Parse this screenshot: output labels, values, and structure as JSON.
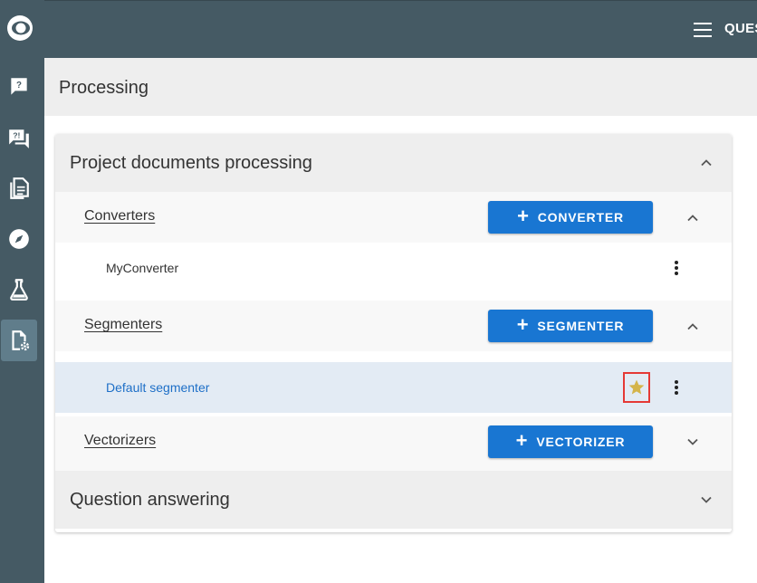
{
  "app": {
    "title_truncated": "QUES"
  },
  "sidebar": {
    "items": [
      {
        "icon": "question-chat-icon"
      },
      {
        "icon": "forum-alert-icon"
      },
      {
        "icon": "documents-icon"
      },
      {
        "icon": "compass-icon"
      },
      {
        "icon": "flask-icon"
      },
      {
        "icon": "file-settings-icon",
        "active": true
      }
    ]
  },
  "page": {
    "title": "Processing"
  },
  "panels": {
    "documents": {
      "title": "Project documents processing",
      "converters": {
        "label": "Converters",
        "button": "CONVERTER",
        "items": [
          "MyConverter"
        ]
      },
      "segmenters": {
        "label": "Segmenters",
        "button": "SEGMENTER",
        "items": [
          "Default segmenter"
        ]
      },
      "vectorizers": {
        "label": "Vectorizers",
        "button": "VECTORIZER"
      }
    },
    "qa": {
      "title": "Question answering"
    }
  },
  "colors": {
    "sidebar": "#455a64",
    "accent": "#1976d2",
    "star": "#d4b44a",
    "highlight": "#e53935"
  }
}
